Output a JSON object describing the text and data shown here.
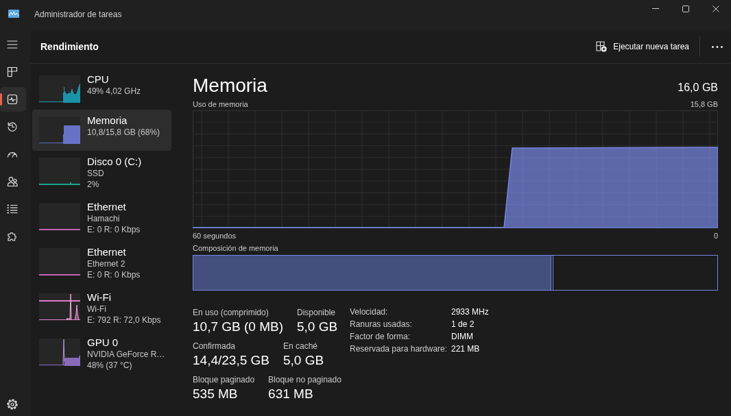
{
  "window": {
    "title": "Administrador de tareas"
  },
  "nav_rail": {
    "items": [
      {
        "kind": "processes",
        "selected": false
      },
      {
        "kind": "performance",
        "selected": true
      },
      {
        "kind": "app_history",
        "selected": false
      },
      {
        "kind": "startup",
        "selected": false
      },
      {
        "kind": "users",
        "selected": false
      },
      {
        "kind": "details",
        "selected": false
      },
      {
        "kind": "services",
        "selected": false
      }
    ]
  },
  "header": {
    "title": "Rendimiento",
    "action": "Ejecutar nueva tarea"
  },
  "sidebar": {
    "items": [
      {
        "kind": "cpu",
        "title": "CPU",
        "lines": [
          "49% 4,02 GHz"
        ],
        "color": "#1a93a8",
        "selected": false
      },
      {
        "kind": "memory",
        "title": "Memoria",
        "lines": [
          "10,8/15,8 GB (68%)"
        ],
        "color": "#6673c6",
        "selected": true
      },
      {
        "kind": "disk",
        "title": "Disco 0 (C:)",
        "lines": [
          "SSD",
          "2%"
        ],
        "color": "#19a58c",
        "selected": false
      },
      {
        "kind": "ethernet",
        "title": "Ethernet",
        "lines": [
          "Hamachi",
          "E: 0 R: 0 Kbps"
        ],
        "color": "#c862ac",
        "selected": false
      },
      {
        "kind": "ethernet",
        "title": "Ethernet",
        "lines": [
          "Ethernet 2",
          "E: 0 R: 0 Kbps"
        ],
        "color": "#c862ac",
        "selected": false
      },
      {
        "kind": "wifi",
        "title": "Wi-Fi",
        "lines": [
          "Wi-Fi",
          "E: 792 R: 72,0 Kbps"
        ],
        "color": "#e27bcb",
        "selected": false
      },
      {
        "kind": "gpu",
        "title": "GPU 0",
        "lines": [
          "NVIDIA GeForce R…",
          "48% (37 °C)"
        ],
        "color": "#8a68ba",
        "selected": false
      }
    ]
  },
  "detail": {
    "title": "Memoria",
    "total": "16,0 GB",
    "usage_graph": {
      "title": "Uso de memoria",
      "max_label": "15,8 GB",
      "start_label": "60 segundos",
      "end_label": "0"
    },
    "composition": {
      "label": "Composición de memoria",
      "segments": [
        {
          "kind": "in_use",
          "level": 0.683
        },
        {
          "kind": "modified",
          "level": 0.004
        }
      ]
    },
    "stat_rows": [
      [
        {
          "label": "En uso (comprimido)",
          "value": "10,7 GB (0 MB)"
        },
        {
          "label": "Disponible",
          "value": "5,0 GB"
        }
      ],
      [
        {
          "label": "Confirmada",
          "value": "14,4/23,5 GB"
        },
        {
          "label": "En caché",
          "value": "5,0 GB"
        }
      ],
      [
        {
          "label": "Bloque paginado",
          "value": "535 MB"
        },
        {
          "label": "Bloque no paginado",
          "value": "631 MB"
        }
      ]
    ],
    "properties": [
      {
        "label": "Velocidad:",
        "value": "2933 MHz"
      },
      {
        "label": "Ranuras usadas:",
        "value": "1 de 2"
      },
      {
        "label": "Factor de forma:",
        "value": "DIMM"
      },
      {
        "label": "Reservada para hardware:",
        "value": "221 MB"
      }
    ]
  }
}
